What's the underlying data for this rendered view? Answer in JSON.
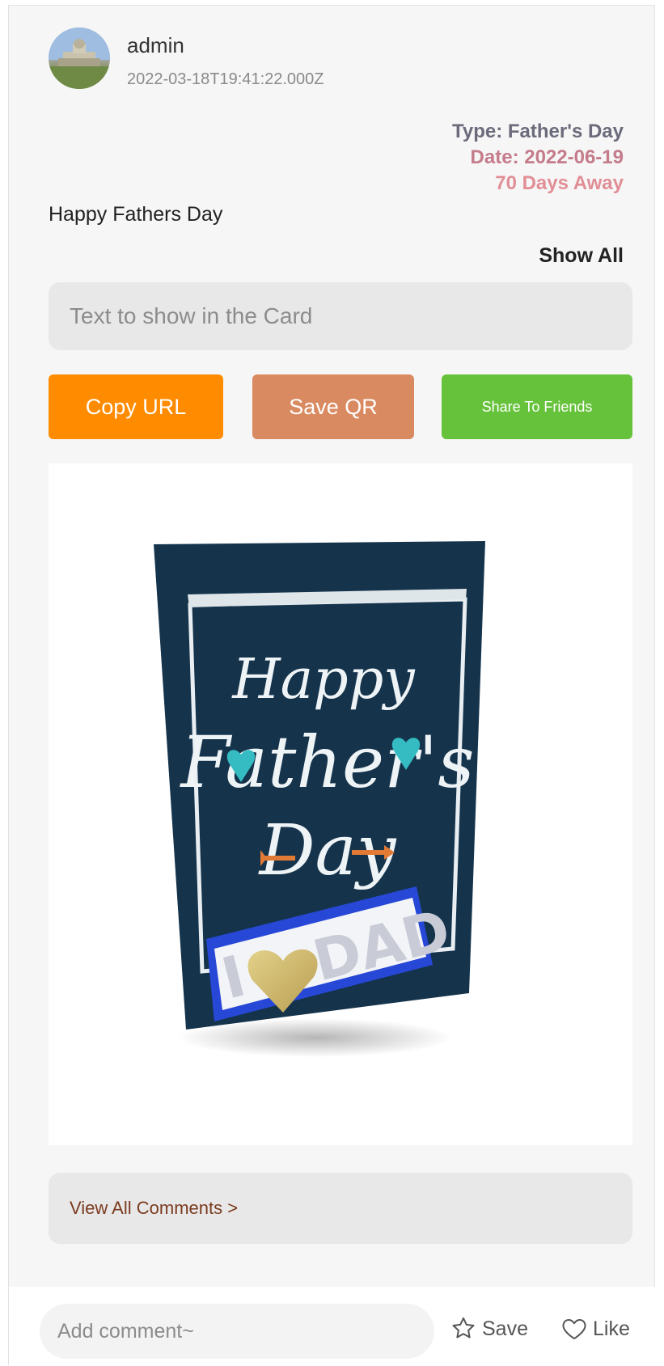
{
  "post": {
    "username": "admin",
    "timestamp": "2022-03-18T19:41:22.000Z",
    "type_line": "Type: Father's Day",
    "date_line": "Date: 2022-06-19",
    "away_line": "70 Days Away",
    "message": "Happy Fathers Day",
    "show_all": "Show All"
  },
  "card_text_input": {
    "placeholder": "Text to show in the Card",
    "value": ""
  },
  "buttons": {
    "copy_url": "Copy URL",
    "save_qr": "Save QR",
    "share": "Share To Friends"
  },
  "greeting_card": {
    "line1": "Happy",
    "line2": "Father's",
    "line3": "Day",
    "stand_text": "DAD",
    "stand_letter": "I"
  },
  "comments": {
    "view_all": "View All Comments >"
  },
  "footer": {
    "comment_placeholder": "Add comment~",
    "save_label": "Save",
    "like_label": "Like"
  },
  "colors": {
    "copy_url": "#ff8c00",
    "save_qr": "#d98a60",
    "share": "#66c23a",
    "card_navy": "#15344c"
  },
  "icons": [
    "user-avatar",
    "star-icon",
    "heart-icon"
  ]
}
